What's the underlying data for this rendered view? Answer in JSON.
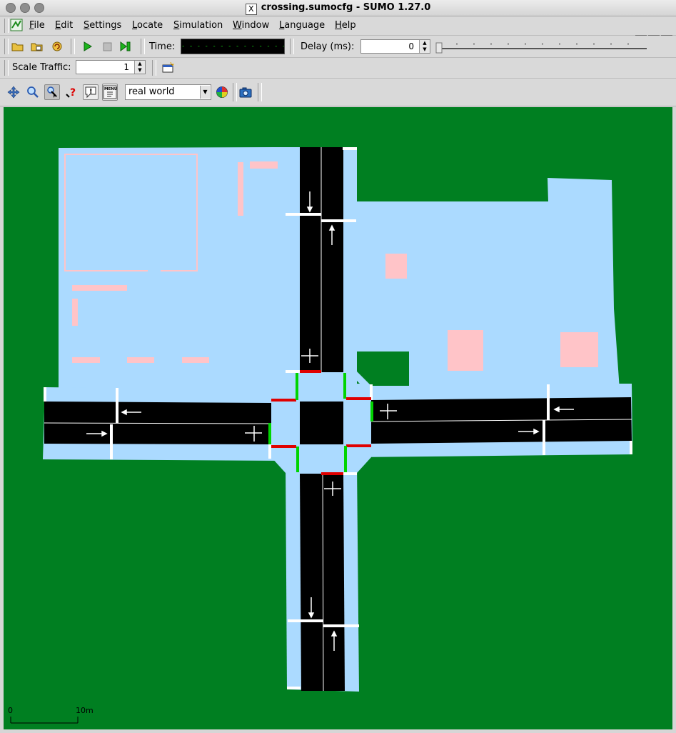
{
  "window": {
    "title": "crossing.sumocfg - SUMO 1.27.0"
  },
  "menu": {
    "items": [
      {
        "label": "File",
        "mnemonic": "F",
        "rest": "ile"
      },
      {
        "label": "Edit",
        "mnemonic": "E",
        "rest": "dit"
      },
      {
        "label": "Settings",
        "mnemonic": "S",
        "rest": "ettings"
      },
      {
        "label": "Locate",
        "mnemonic": "L",
        "rest": "ocate"
      },
      {
        "label": "Simulation",
        "mnemonic": "S",
        "rest": "imulation"
      },
      {
        "label": "Window",
        "mnemonic": "W",
        "rest": "indow"
      },
      {
        "label": "Language",
        "mnemonic": "L",
        "rest": "anguage"
      },
      {
        "label": "Help",
        "mnemonic": "H",
        "rest": "elp"
      }
    ]
  },
  "toolbar": {
    "time_label": "Time:",
    "time_value": "- - - - - - - - - - - - - -",
    "delay_label": "Delay (ms):",
    "delay_value": "0",
    "scale_label": "Scale Traffic:",
    "scale_value": "1"
  },
  "view": {
    "scheme": "real world"
  },
  "scale_bar": {
    "start": "0",
    "end": "10m"
  },
  "colors": {
    "grass": "#007f21",
    "sidewalk": "#abdaff",
    "road": "#000000",
    "building": "#ffc4c8",
    "signal_green": "#00d400",
    "signal_red": "#e00000"
  }
}
